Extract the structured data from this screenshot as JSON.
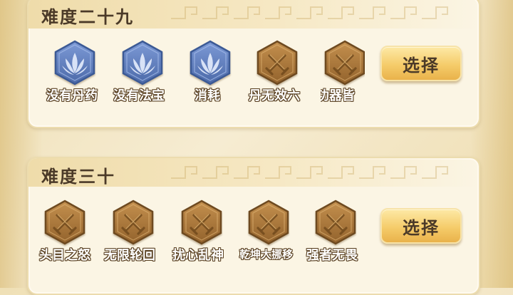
{
  "colors": {
    "blue_badge": "#5b7cbf",
    "bronze_badge": "#a9783e",
    "button": "#f5cc6a",
    "title_text": "#4b3a28"
  },
  "levels": [
    {
      "title": "难度二十九",
      "select_label": "选择",
      "badges": [
        {
          "label": "没有丹药",
          "icon": "lotus-icon",
          "style": "blue"
        },
        {
          "label": "没有法宝",
          "icon": "lotus-icon",
          "style": "blue"
        },
        {
          "label": "消耗",
          "icon": "lotus-icon",
          "style": "blue"
        },
        {
          "label": "丹无效六",
          "icon": "swords-icon",
          "style": "bronze"
        },
        {
          "label": "功器皆",
          "icon": "swords-icon",
          "style": "bronze"
        }
      ]
    },
    {
      "title": "难度三十",
      "select_label": "选择",
      "badges": [
        {
          "label": "头目之怒",
          "icon": "swords-icon",
          "style": "bronze"
        },
        {
          "label": "无限轮回",
          "icon": "swords-icon",
          "style": "bronze"
        },
        {
          "label": "扰心乱神",
          "icon": "swords-icon",
          "style": "bronze"
        },
        {
          "label": "乾坤大挪移",
          "icon": "swords-icon",
          "style": "bronze"
        },
        {
          "label": "强者无畏",
          "icon": "swords-icon",
          "style": "bronze"
        }
      ]
    }
  ]
}
